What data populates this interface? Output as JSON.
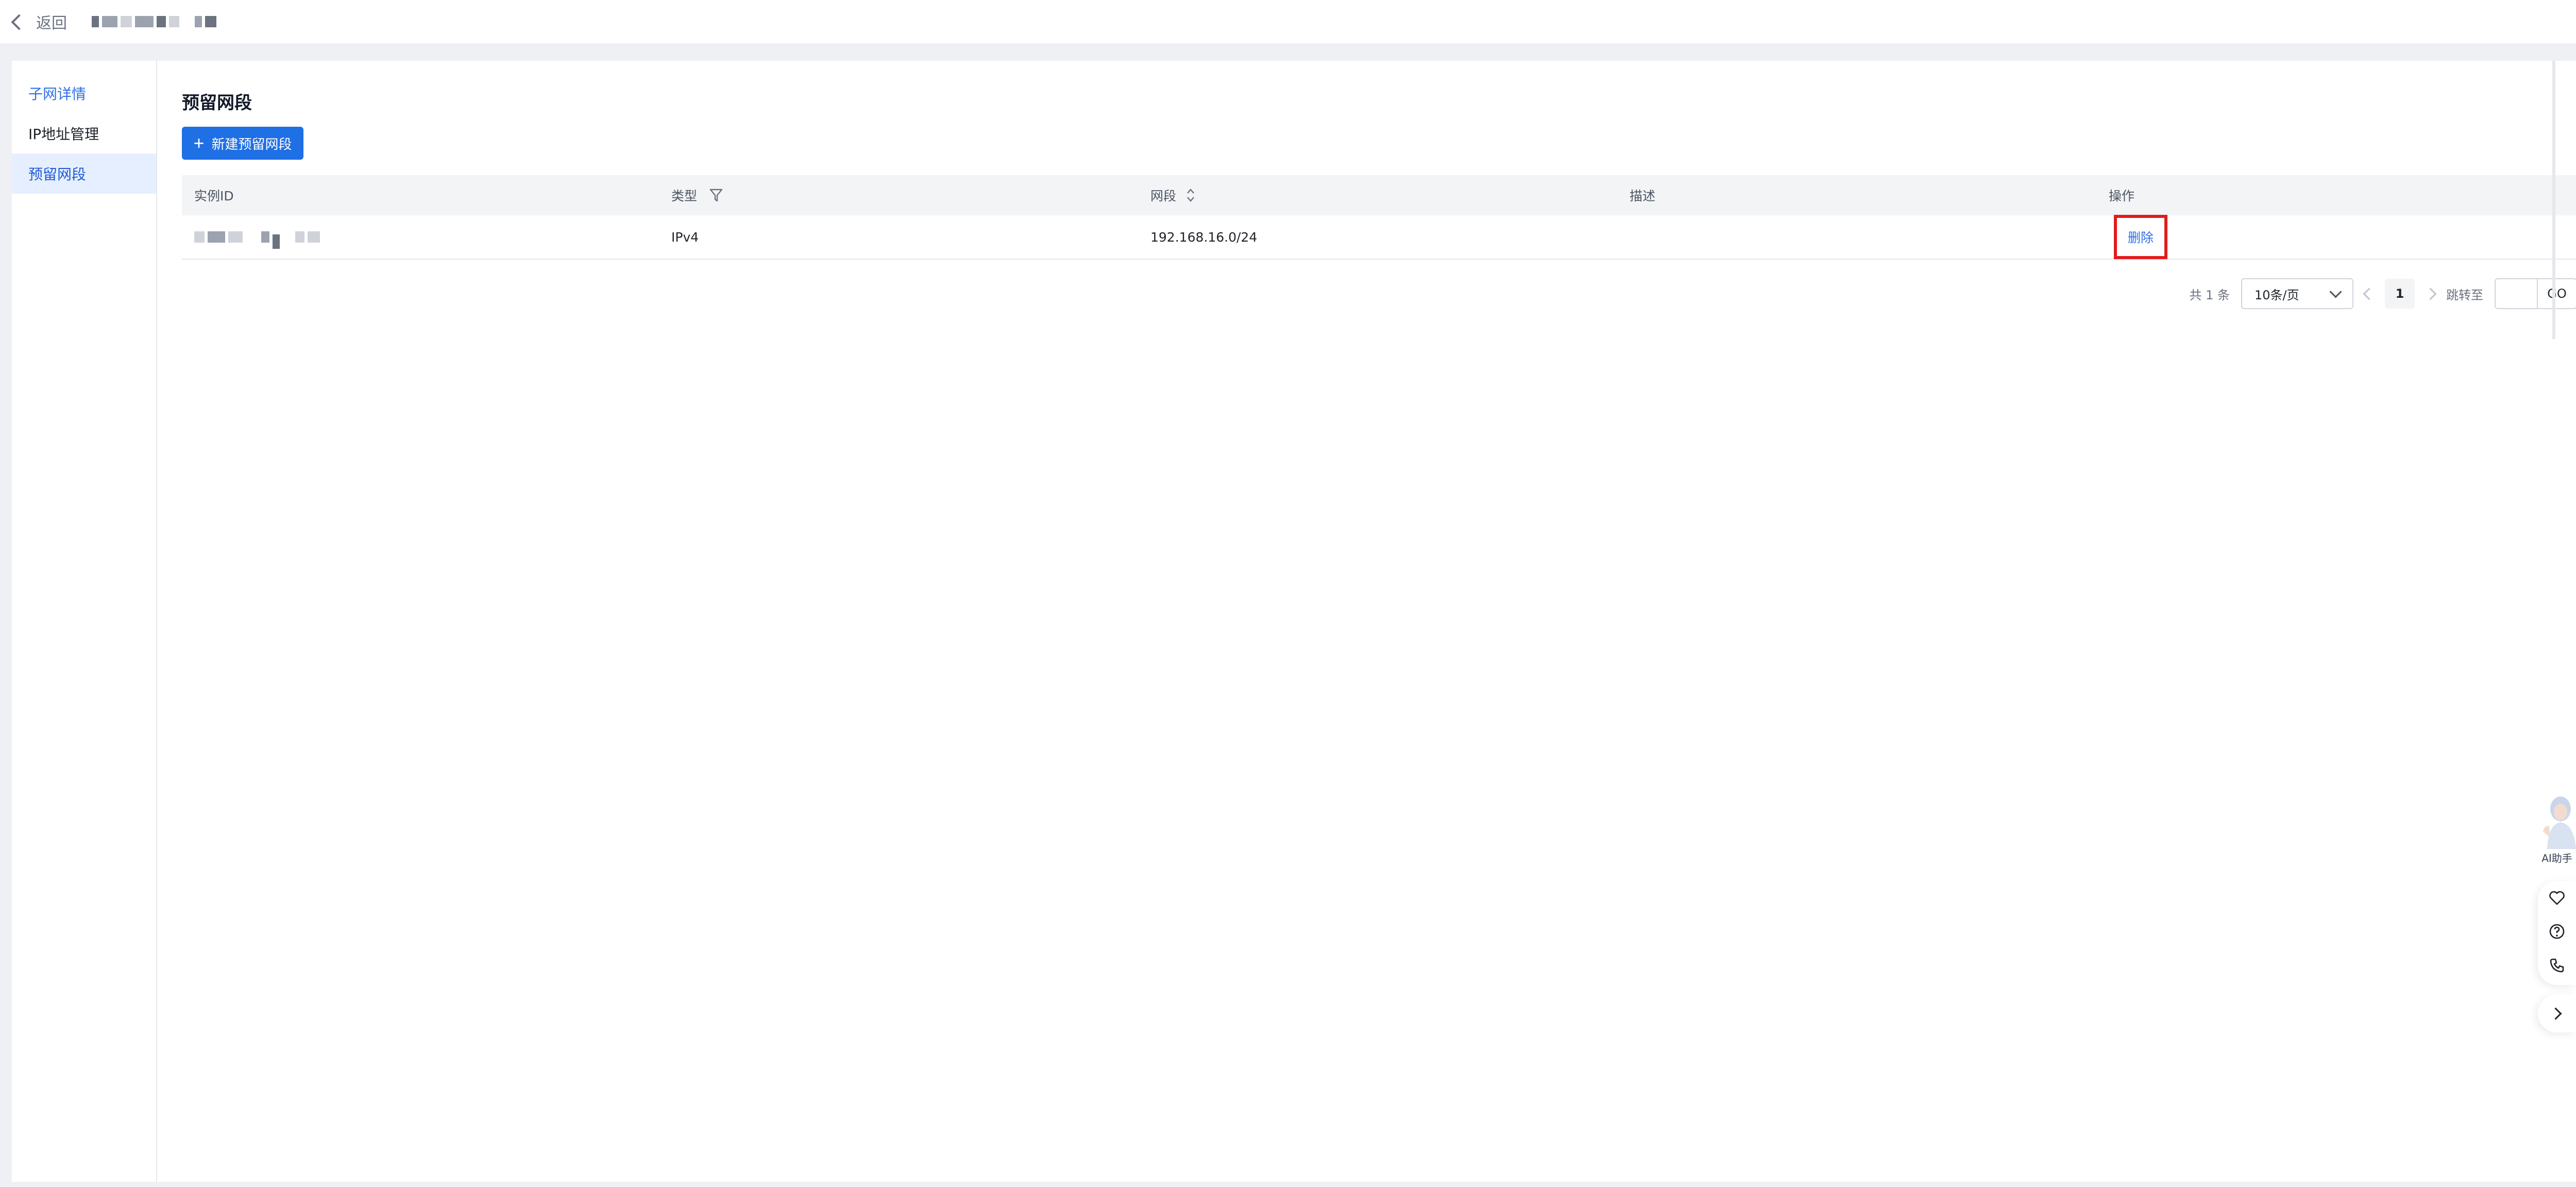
{
  "topbar": {
    "back_label": "返回"
  },
  "sidebar": {
    "items": [
      {
        "label": "子网详情"
      },
      {
        "label": "IP地址管理"
      },
      {
        "label": "预留网段"
      }
    ]
  },
  "main": {
    "title": "预留网段",
    "new_button_label": "新建预留网段"
  },
  "table": {
    "columns": [
      "实例ID",
      "类型",
      "网段",
      "描述",
      "操作"
    ],
    "rows": [
      {
        "type": "IPv4",
        "cidr": "192.168.16.0/24",
        "description": "",
        "action": "删除"
      }
    ]
  },
  "pagination": {
    "total_text": "共 1 条",
    "page_size": "10条/页",
    "current_page": "1",
    "jump_label": "跳转至",
    "go_label": "GO"
  },
  "assistant": {
    "label": "AI助手"
  },
  "colors": {
    "accent": "#1f6fe5",
    "highlight_box": "#e21b1b"
  }
}
